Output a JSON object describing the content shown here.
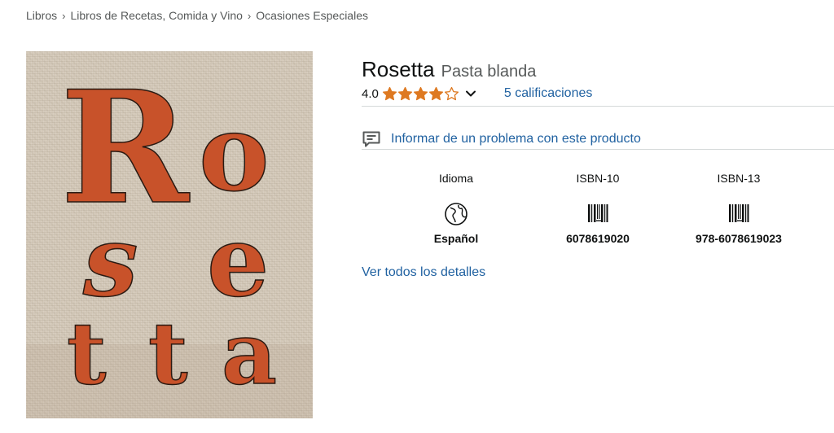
{
  "breadcrumb": {
    "items": [
      "Libros",
      "Libros de Recetas, Comida y Vino",
      "Ocasiones Especiales"
    ],
    "separator": "›"
  },
  "cover": {
    "letters": [
      "R",
      "o",
      "s",
      "e",
      "t",
      "t",
      "a"
    ],
    "letter_color": "#c8522a",
    "background_color": "#d4c9b9"
  },
  "product": {
    "title": "Rosetta",
    "binding": "Pasta blanda"
  },
  "rating": {
    "value": "4.0",
    "stars_filled": 4,
    "stars_total": 5,
    "count_label": "5 calificaciones",
    "star_color": "#de7921"
  },
  "report": {
    "label": "Informar de un problema con este producto",
    "icon": "feedback-icon"
  },
  "details": [
    {
      "label": "Idioma",
      "icon": "globe-icon",
      "value": "Español"
    },
    {
      "label": "ISBN-10",
      "icon": "barcode-icon",
      "value": "6078619020"
    },
    {
      "label": "ISBN-13",
      "icon": "barcode-icon",
      "value": "978-6078619023"
    }
  ],
  "see_all_details": "Ver todos los detalles",
  "colors": {
    "link": "#2162a1",
    "text": "#0f1111",
    "muted": "#565959"
  }
}
